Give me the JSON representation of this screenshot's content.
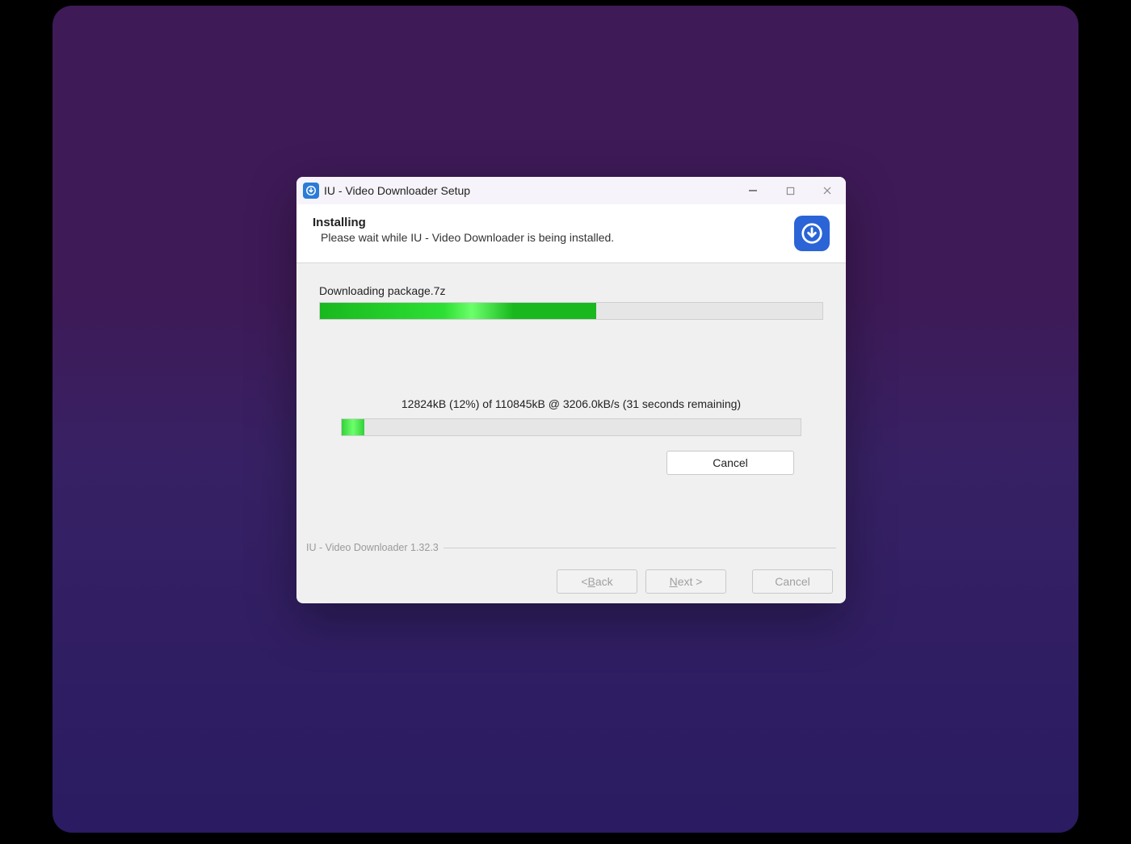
{
  "window": {
    "title": "IU - Video Downloader Setup"
  },
  "header": {
    "title": "Installing",
    "subtitle": "Please wait while IU - Video Downloader is being installed."
  },
  "download": {
    "task_label": "Downloading package.7z",
    "main_progress_percent": 55,
    "status_line": "12824kB (12%) of 110845kB @ 3206.0kB/s (31 seconds remaining)",
    "sub_progress_percent": 5,
    "cancel_label": "Cancel"
  },
  "footer": {
    "brand": "IU - Video Downloader 1.32.3",
    "back_prefix": "< ",
    "back_mnemonic": "B",
    "back_suffix": "ack",
    "next_mnemonic": "N",
    "next_suffix": "ext >",
    "cancel_label": "Cancel"
  }
}
